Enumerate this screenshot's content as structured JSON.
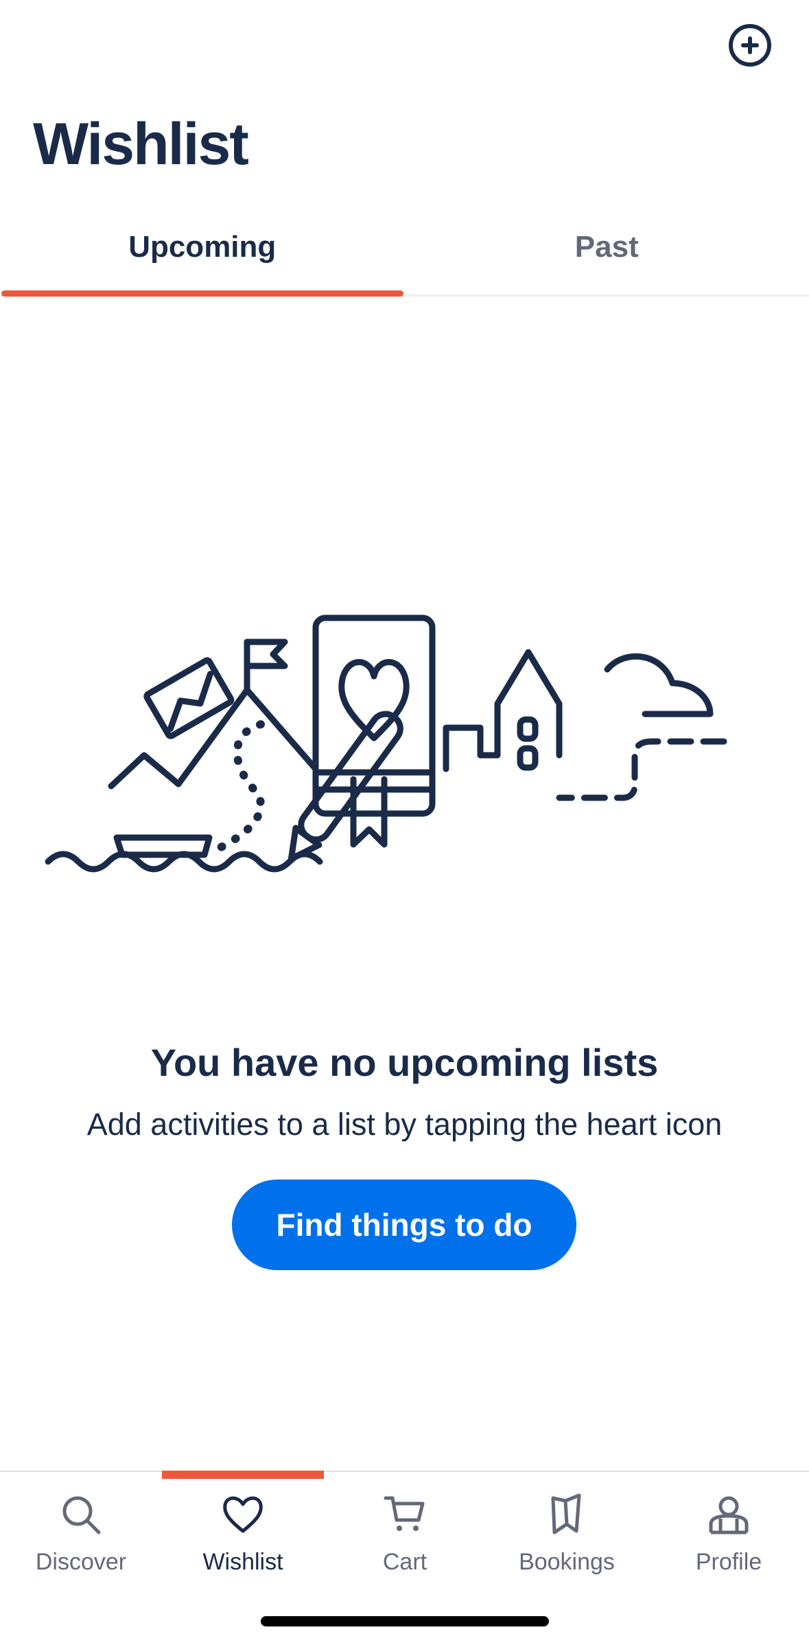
{
  "header": {
    "title": "Wishlist",
    "add_icon": "plus-circle-icon"
  },
  "tabs": [
    {
      "label": "Upcoming",
      "active": true
    },
    {
      "label": "Past",
      "active": false
    }
  ],
  "illustration": "wishlist-travel-illustration",
  "empty_state": {
    "title": "You have no upcoming lists",
    "subtitle": "Add activities to a list by tapping the heart icon",
    "button_label": "Find things to do"
  },
  "bottom_nav": [
    {
      "label": "Discover",
      "icon": "search-icon",
      "active": false
    },
    {
      "label": "Wishlist",
      "icon": "heart-icon",
      "active": true
    },
    {
      "label": "Cart",
      "icon": "cart-icon",
      "active": false
    },
    {
      "label": "Bookings",
      "icon": "bookmark-icon",
      "active": false
    },
    {
      "label": "Profile",
      "icon": "profile-icon",
      "active": false
    }
  ],
  "colors": {
    "primary_text": "#1a2b49",
    "secondary_text": "#63687a",
    "accent": "#f0573a",
    "cta_blue": "#0071eb"
  }
}
